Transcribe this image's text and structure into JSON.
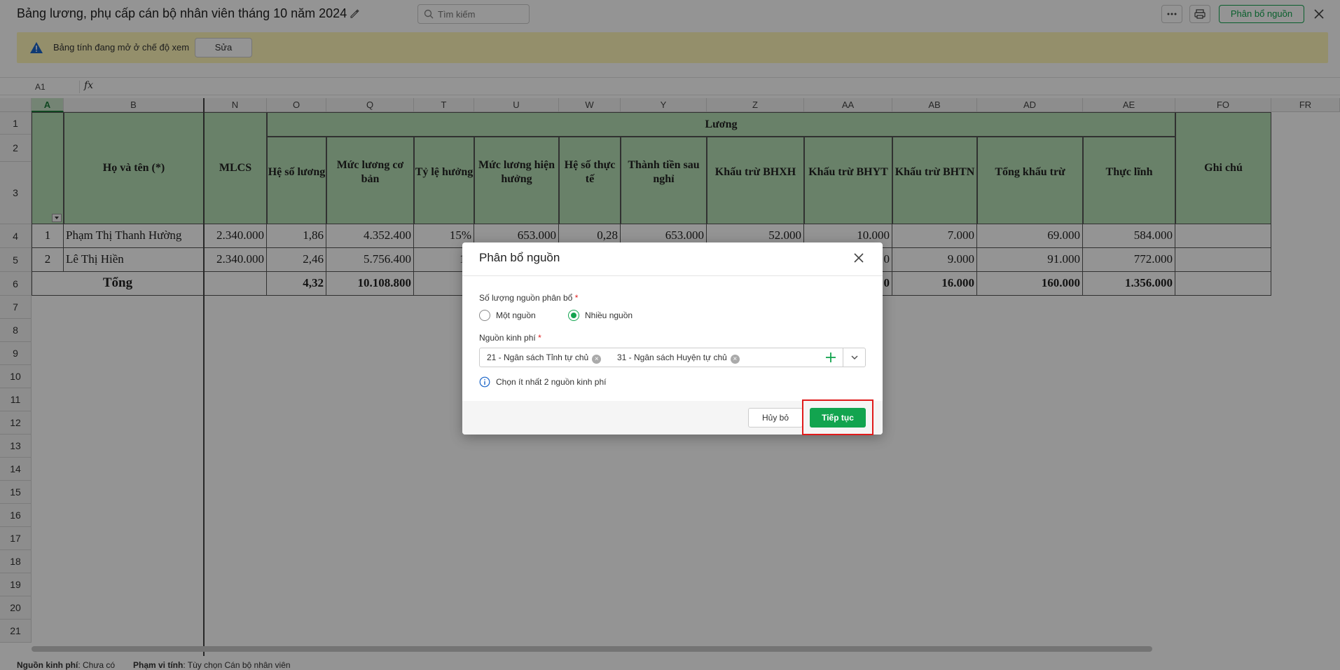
{
  "header": {
    "title": "Bảng lương, phụ cấp cán bộ nhân viên tháng 10 năm 2024",
    "search_placeholder": "Tìm kiếm",
    "allocate_button": "Phân bổ nguồn"
  },
  "banner": {
    "text": "Bảng tính đang mở ở chế độ xem",
    "edit_button": "Sửa"
  },
  "formula_bar": {
    "cell_ref": "A1",
    "fx": "fx"
  },
  "columns": [
    "A",
    "B",
    "N",
    "O",
    "Q",
    "T",
    "U",
    "W",
    "Y",
    "Z",
    "AA",
    "AB",
    "AD",
    "AE",
    "FO",
    "FR"
  ],
  "rows": [
    "1",
    "2",
    "3",
    "4",
    "5",
    "6",
    "7",
    "8",
    "9",
    "10",
    "11",
    "12",
    "13",
    "14",
    "15",
    "16",
    "17",
    "18",
    "19",
    "20",
    "21"
  ],
  "table_header": {
    "name": "Họ và tên (*)",
    "mlcs": "MLCS",
    "group": "Lương",
    "sub": [
      "Hệ số lương",
      "Mức lương cơ bản",
      "Tỷ lệ hưởng",
      "Mức lương hiện hưởng",
      "Hệ số thực tế",
      "Thành tiền sau nghỉ",
      "Khấu trừ BHXH",
      "Khấu trừ BHYT",
      "Khấu trừ BHTN",
      "Tổng khấu trừ",
      "Thực lĩnh"
    ],
    "note": "Ghi chú"
  },
  "table_rows": [
    {
      "stt": "1",
      "name": "Phạm Thị Thanh  Hường",
      "mlcs": "2.340.000",
      "he_so": "1,86",
      "muc_co_ban": "4.352.400",
      "ty_le": "15%",
      "hien_huong": "653.000",
      "thuc_te": "0,28",
      "sau_nghi": "653.000",
      "bhxh": "52.000",
      "bhyt": "10.000",
      "bhtn": "7.000",
      "tong_kt": "69.000",
      "thuc_linh": "584.000"
    },
    {
      "stt": "2",
      "name": "Lê Thị Hiền",
      "mlcs": "2.340.000",
      "he_so": "2,46",
      "muc_co_ban": "5.756.400",
      "ty_le": "15",
      "bhyt": "0",
      "bhtn": "9.000",
      "tong_kt": "91.000",
      "thuc_linh": "772.000"
    }
  ],
  "total_row": {
    "label": "Tổng",
    "he_so": "4,32",
    "muc_co_ban": "10.108.800",
    "bhyt": "0",
    "bhtn": "16.000",
    "tong_kt": "160.000",
    "thuc_linh": "1.356.000"
  },
  "footer": {
    "source_label": "Nguồn kinh phí",
    "source_value": ": Chưa có",
    "scope_label": "Phạm vi tính",
    "scope_value": ": Tùy chọn Cán bộ nhân viên"
  },
  "modal": {
    "title": "Phân bổ nguồn",
    "count_label": "Số lượng nguồn phân bổ",
    "required_mark": "*",
    "option_one": "Một nguồn",
    "option_many": "Nhiều nguồn",
    "selected_option": "Nhiều nguồn",
    "fund_label": "Nguồn kinh phí",
    "tags": [
      "21 - Ngân sách Tỉnh tự chủ",
      "31 - Ngân sách Huyện tự chủ"
    ],
    "hint": "Chọn ít nhất 2 nguồn kinh phí",
    "cancel_button": "Hủy bỏ",
    "continue_button": "Tiếp tục"
  },
  "colors": {
    "accent": "#12a44f",
    "header_fill": "#b6deb6",
    "banner": "#fff7b8",
    "highlight": "#e01b1b"
  }
}
